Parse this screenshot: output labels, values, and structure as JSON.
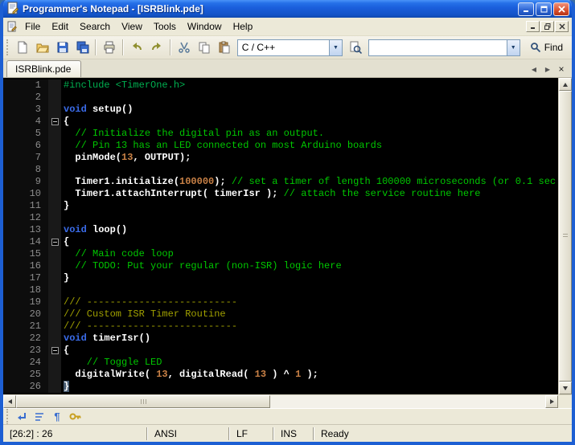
{
  "window": {
    "title": "Programmer's Notepad - [ISRBlink.pde]"
  },
  "menu": {
    "items": [
      "File",
      "Edit",
      "Search",
      "View",
      "Tools",
      "Window",
      "Help"
    ]
  },
  "toolbar": {
    "language_combo": {
      "value": "C / C++"
    },
    "search_combo": {
      "value": ""
    },
    "find_button": "Find"
  },
  "tabs": [
    {
      "label": "ISRBlink.pde",
      "active": true
    }
  ],
  "icons": {
    "dropdown_arrow": "▼",
    "tab_prev": "◀",
    "tab_next": "▶",
    "tab_close": "×",
    "pilcrow": "¶"
  },
  "editor": {
    "colors": {
      "background": "#000000",
      "preprocessor": "#00b050",
      "comment": "#00c800",
      "doc_comment": "#a0a000",
      "keyword": "#3a6be8",
      "number": "#c98146",
      "default": "#ffffff",
      "gutter_text": "#8c8c8c",
      "brace_highlight_bg": "#4a5e74"
    },
    "lines": [
      {
        "n": 1,
        "s": [
          [
            "#include <TimerOne.h>",
            "p"
          ]
        ]
      },
      {
        "n": 2,
        "s": []
      },
      {
        "n": 3,
        "s": [
          [
            "void",
            "k"
          ],
          [
            " setup()",
            "w"
          ]
        ]
      },
      {
        "n": 4,
        "fold": true,
        "s": [
          [
            "{",
            "w"
          ]
        ]
      },
      {
        "n": 5,
        "s": [
          [
            "  // Initialize the digital pin as an output.",
            "c"
          ]
        ]
      },
      {
        "n": 6,
        "s": [
          [
            "  // Pin 13 has an LED connected on most Arduino boards",
            "c"
          ]
        ]
      },
      {
        "n": 7,
        "s": [
          [
            "  pinMode(",
            "w"
          ],
          [
            "13",
            "n"
          ],
          [
            ", OUTPUT);",
            "w"
          ]
        ]
      },
      {
        "n": 8,
        "s": []
      },
      {
        "n": 9,
        "s": [
          [
            "  Timer1.initialize(",
            "w"
          ],
          [
            "100000",
            "n"
          ],
          [
            "); ",
            "w"
          ],
          [
            "// set a timer of length 100000 microseconds (or 0.1 sec",
            "c"
          ]
        ]
      },
      {
        "n": 10,
        "s": [
          [
            "  Timer1.attachInterrupt( timerIsr ); ",
            "w"
          ],
          [
            "// attach the service routine here",
            "c"
          ]
        ]
      },
      {
        "n": 11,
        "s": [
          [
            "}",
            "w"
          ]
        ]
      },
      {
        "n": 12,
        "s": []
      },
      {
        "n": 13,
        "s": [
          [
            "void",
            "k"
          ],
          [
            " loop()",
            "w"
          ]
        ]
      },
      {
        "n": 14,
        "fold": true,
        "s": [
          [
            "{",
            "w"
          ]
        ]
      },
      {
        "n": 15,
        "s": [
          [
            "  // Main code loop",
            "c"
          ]
        ]
      },
      {
        "n": 16,
        "s": [
          [
            "  // TODO: Put your regular (non-ISR) logic here",
            "c"
          ]
        ]
      },
      {
        "n": 17,
        "s": [
          [
            "}",
            "w"
          ]
        ]
      },
      {
        "n": 18,
        "s": []
      },
      {
        "n": 19,
        "s": [
          [
            "/// --------------------------",
            "d"
          ]
        ]
      },
      {
        "n": 20,
        "s": [
          [
            "/// Custom ISR Timer Routine",
            "d"
          ]
        ]
      },
      {
        "n": 21,
        "s": [
          [
            "/// --------------------------",
            "d"
          ]
        ]
      },
      {
        "n": 22,
        "s": [
          [
            "void",
            "k"
          ],
          [
            " timerIsr()",
            "w"
          ]
        ]
      },
      {
        "n": 23,
        "fold": true,
        "s": [
          [
            "{",
            "w"
          ]
        ]
      },
      {
        "n": 24,
        "s": [
          [
            "    // Toggle LED",
            "c"
          ]
        ]
      },
      {
        "n": 25,
        "s": [
          [
            "  digitalWrite( ",
            "w"
          ],
          [
            "13",
            "n"
          ],
          [
            ", digitalRead( ",
            "w"
          ],
          [
            "13",
            "n"
          ],
          [
            " ) ^ ",
            "w"
          ],
          [
            "1",
            "n"
          ],
          [
            " );",
            "w"
          ]
        ]
      },
      {
        "n": 26,
        "s": [
          [
            "}",
            "h"
          ]
        ]
      }
    ]
  },
  "statusbar": {
    "position": "[26:2] : 26",
    "encoding": "ANSI",
    "line_ending": "LF",
    "input_mode": "INS",
    "message": "Ready"
  }
}
